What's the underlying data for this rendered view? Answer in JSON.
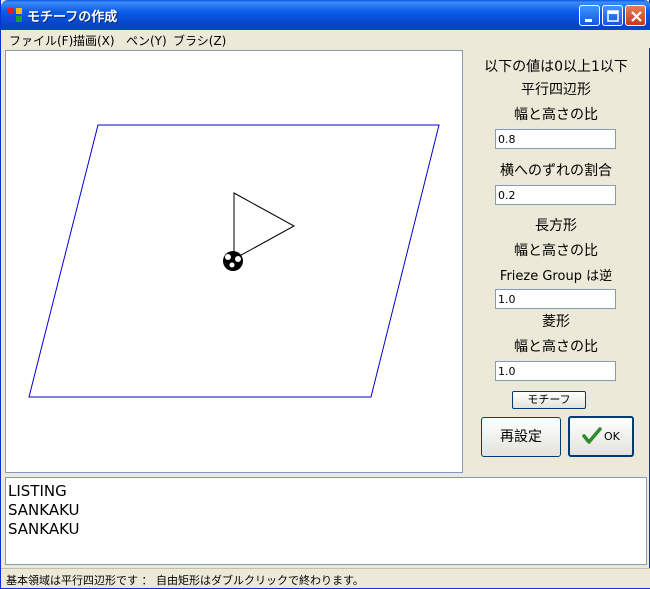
{
  "window": {
    "title": "モチーフの作成"
  },
  "menubar": {
    "items": [
      {
        "label": "ファイル(F)"
      },
      {
        "label": "描画(X)"
      },
      {
        "label": "ペン(Y)"
      },
      {
        "label": "ブラシ(Z)"
      }
    ]
  },
  "canvas": {
    "parallelogram_color": "#0000cc",
    "motif_color": "#000000"
  },
  "panel": {
    "range_note": "以下の値は0以上1以下",
    "parallelogram_heading": "平行四辺形",
    "parallelogram_ratio_label": "幅と高さの比",
    "parallelogram_ratio_value": "0.8",
    "shift_label": "横へのずれの割合",
    "shift_value": "0.2",
    "rectangle_heading": "長方形",
    "rectangle_ratio_label": "幅と高さの比",
    "frieze_label": "Frieze Group は逆",
    "rectangle_ratio_value": "1.0",
    "rhombus_heading": "菱形",
    "rhombus_ratio_label": "幅と高さの比",
    "rhombus_ratio_value": "1.0",
    "motif_button": "モチーフ",
    "reset_button": "再設定",
    "ok_button": "OK"
  },
  "listing": {
    "lines": [
      "LISTING",
      "SANKAKU",
      "SANKAKU"
    ]
  },
  "status": {
    "text": "基本領域は平行四辺形です ： 自由矩形はダブルクリックで終わります。"
  },
  "colors": {
    "titlebar": "#0a5ae8",
    "check_icon": "#2e8b2e"
  }
}
